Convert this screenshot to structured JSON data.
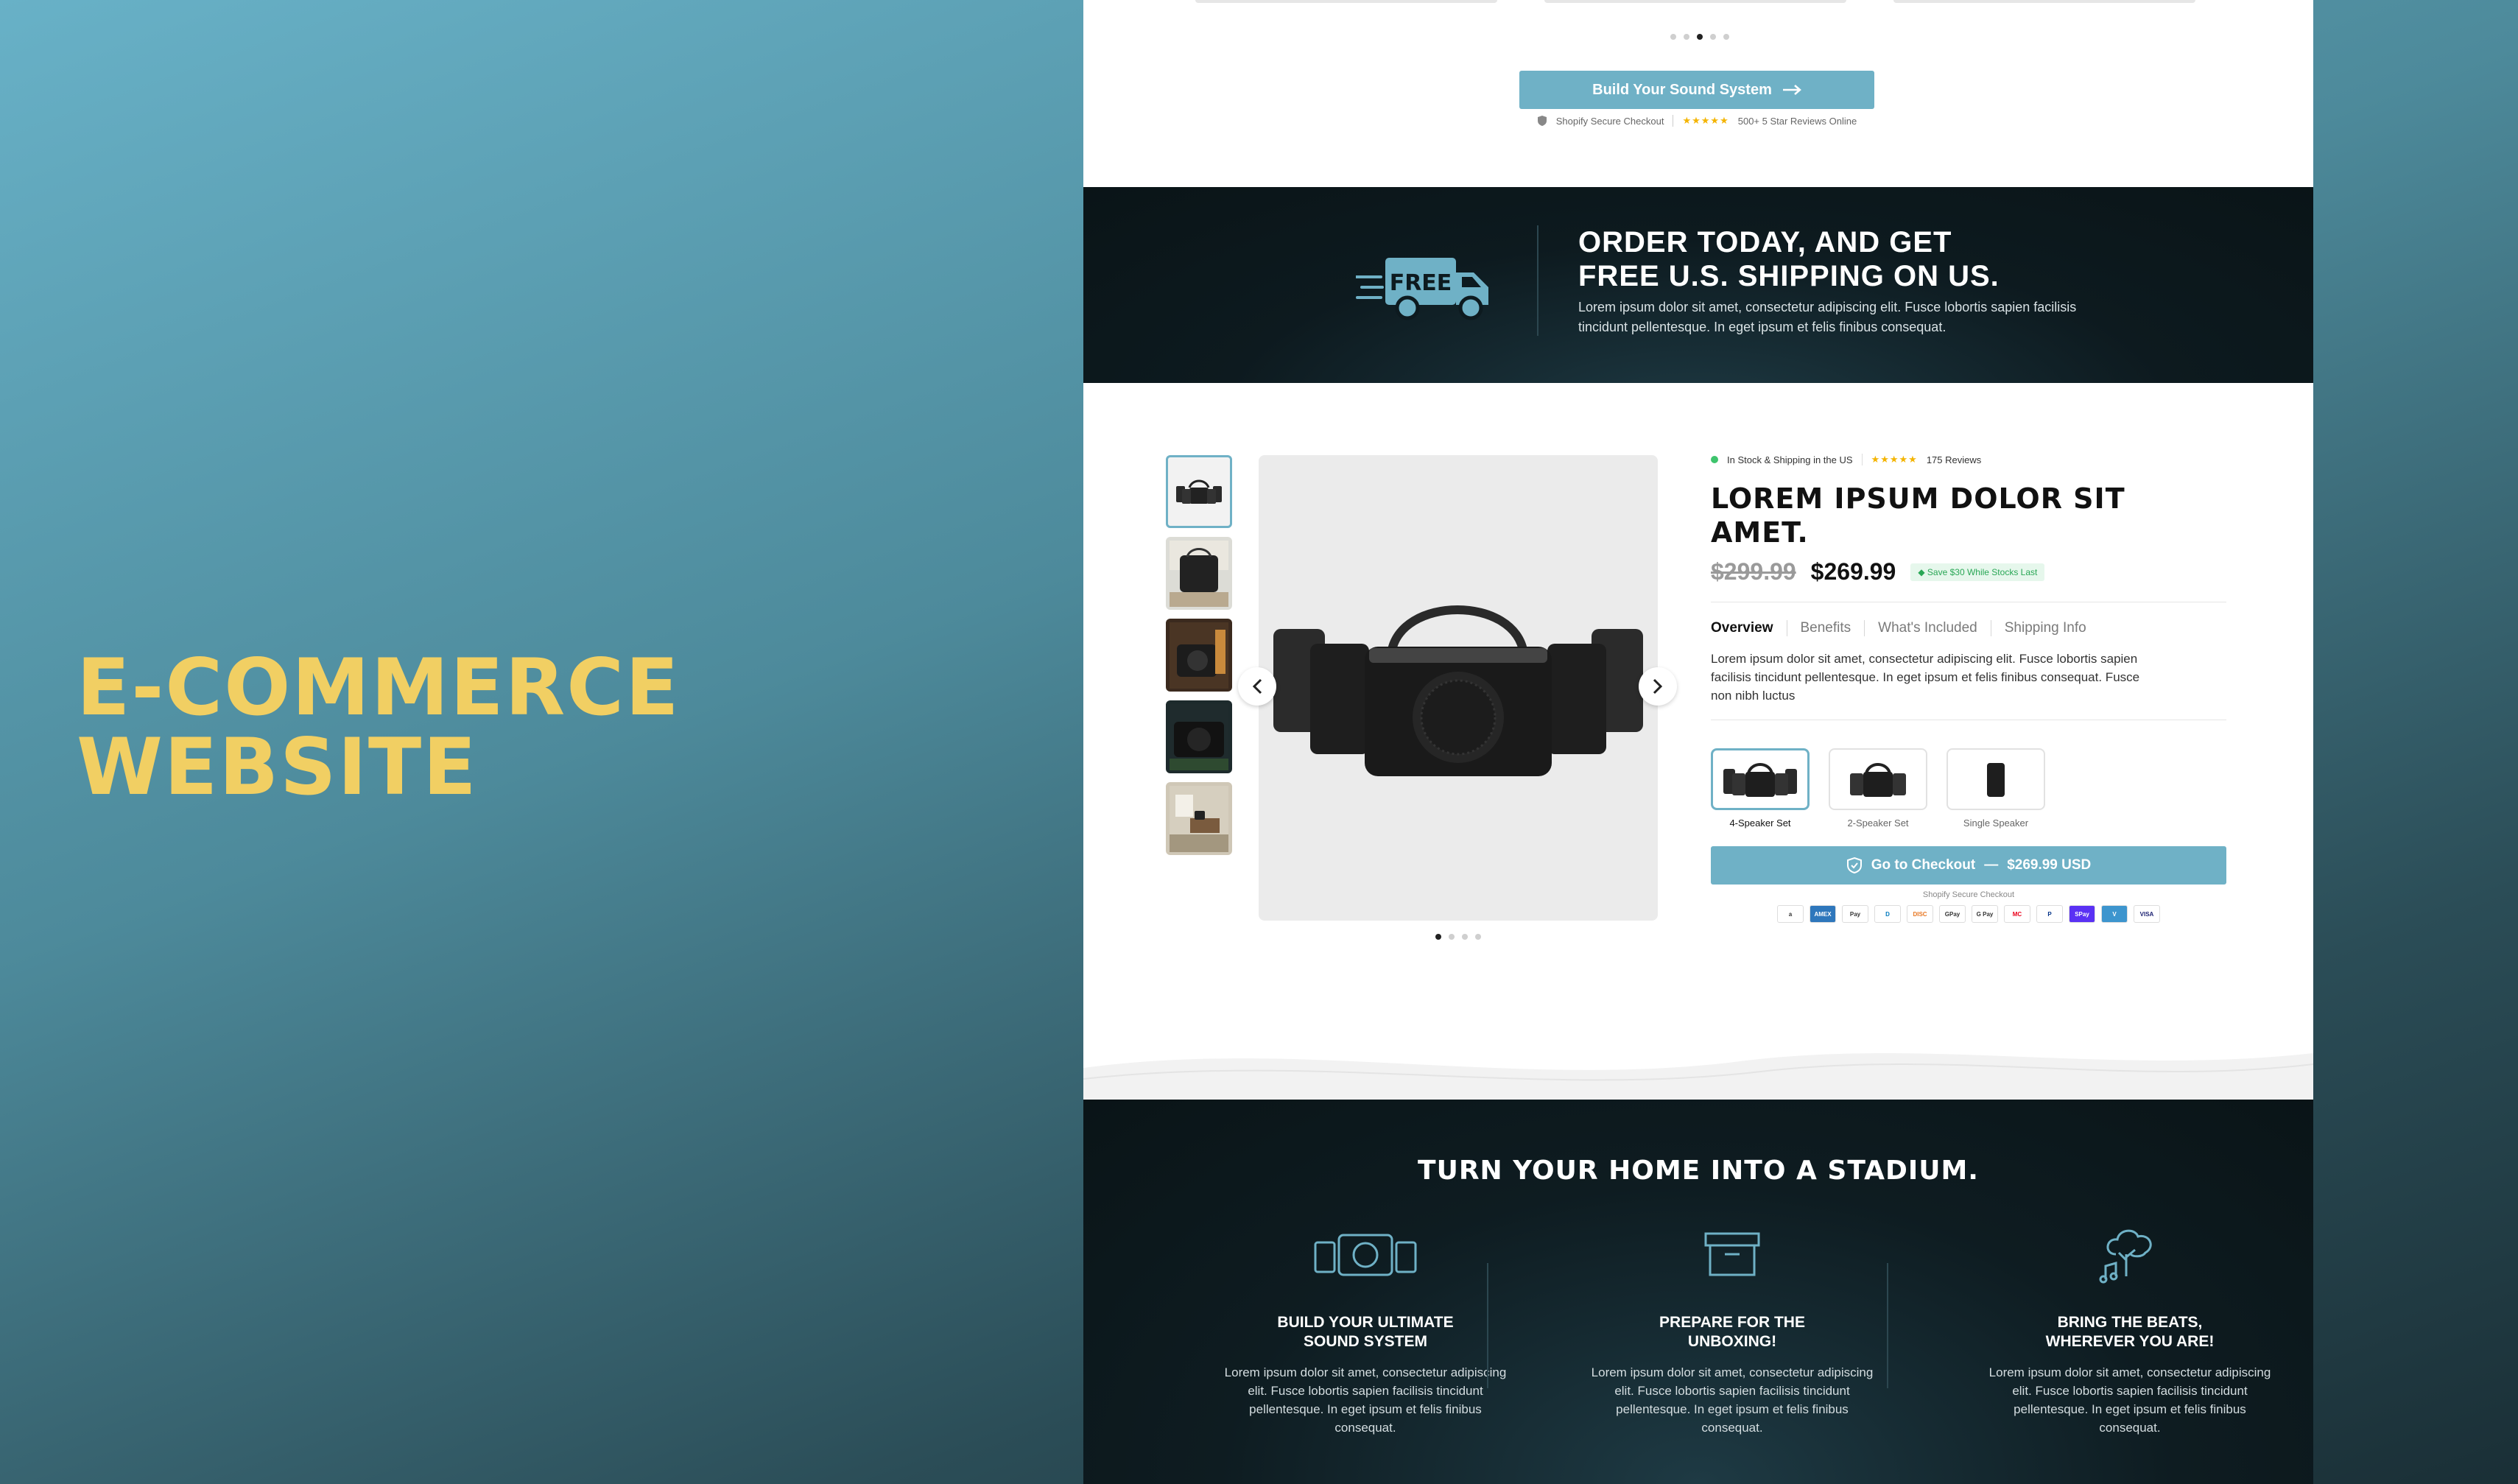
{
  "hero": {
    "line1": "E-COMMERCE",
    "line2": "WEBSITE"
  },
  "top": {
    "build_button": "Build Your Sound System",
    "secure_checkout": "Shopify Secure Checkout",
    "reviews": "500+ 5 Star Reviews Online",
    "stars": "★★★★★"
  },
  "shipping": {
    "truck_label": "FREE",
    "headline_1": "ORDER TODAY, AND GET",
    "headline_2": "FREE U.S. SHIPPING ON US.",
    "body": "Lorem ipsum dolor sit amet, consectetur adipiscing elit. Fusce lobortis sapien facilisis tincidunt pellentesque. In eget ipsum et felis finibus consequat."
  },
  "product": {
    "stock": "In Stock & Shipping in the US",
    "stars": "★★★★★",
    "reviews": "175 Reviews",
    "title": "LOREM IPSUM DOLOR SIT AMET.",
    "old_price": "$299.99",
    "price": "$269.99",
    "save_badge": "Save $30 While Stocks Last",
    "tabs": [
      "Overview",
      "Benefits",
      "What's Included",
      "Shipping Info"
    ],
    "description": "Lorem ipsum dolor sit amet, consectetur adipiscing elit. Fusce lobortis sapien facilisis tincidunt pellentesque. In eget ipsum et felis finibus consequat. Fusce non nibh luctus",
    "variants": [
      "4-Speaker Set",
      "2-Speaker Set",
      "Single Speaker"
    ],
    "checkout_label": "Go to Checkout",
    "checkout_dash": "—",
    "checkout_price": "$269.99 USD",
    "secure_note": "Shopify Secure Checkout",
    "payments": [
      "a",
      "AMEX",
      "Pay",
      "D",
      "DISC",
      "GPay",
      "G Pay",
      "MC",
      "P",
      "SPay",
      "V",
      "VISA"
    ]
  },
  "bottom": {
    "headline": "TURN YOUR HOME INTO A STADIUM.",
    "features": [
      {
        "title_1": "BUILD YOUR ULTIMATE",
        "title_2": "SOUND SYSTEM",
        "text": "Lorem ipsum dolor sit amet, consectetur adipiscing elit. Fusce lobortis sapien facilisis tincidunt pellentesque. In eget ipsum et felis finibus consequat.",
        "icon": "speakers-icon"
      },
      {
        "title_1": "PREPARE FOR THE",
        "title_2": "UNBOXING!",
        "text": "Lorem ipsum dolor sit amet, consectetur adipiscing elit. Fusce lobortis sapien facilisis tincidunt pellentesque. In eget ipsum et felis finibus consequat.",
        "icon": "box-icon"
      },
      {
        "title_1": "BRING THE BEATS,",
        "title_2": "WHEREVER YOU ARE!",
        "text": "Lorem ipsum dolor sit amet, consectetur adipiscing elit. Fusce lobortis sapien facilisis tincidunt pellentesque. In eget ipsum et felis finibus consequat.",
        "icon": "music-tree-icon"
      }
    ]
  },
  "colors": {
    "accent": "#6fb1c6",
    "hero_text": "#f1cf63",
    "dark": "#0d1a1f"
  }
}
